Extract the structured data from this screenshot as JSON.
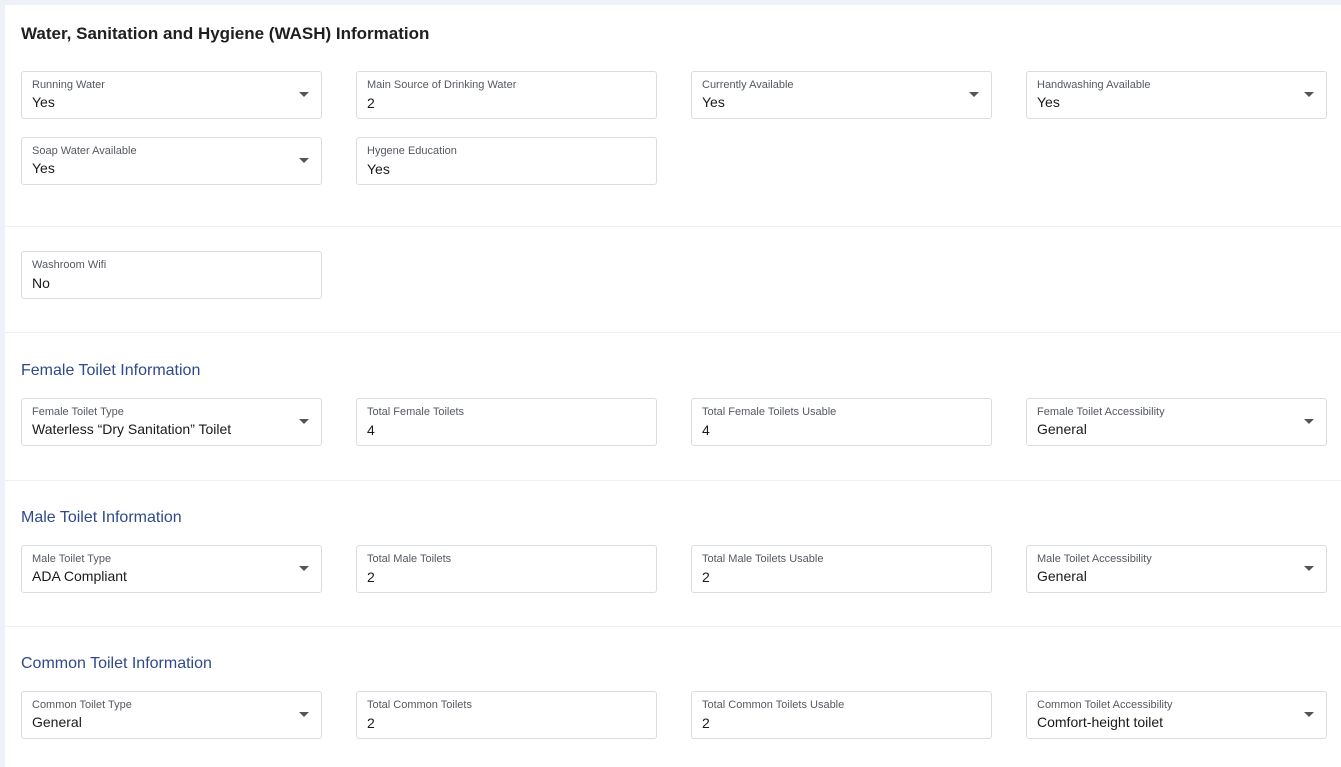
{
  "wash": {
    "title": "Water, Sanitation and Hygiene (WASH) Information",
    "running_water": {
      "label": "Running Water",
      "value": "Yes"
    },
    "main_source": {
      "label": "Main Source of Drinking Water",
      "value": "2"
    },
    "currently_available": {
      "label": "Currently Available",
      "value": "Yes"
    },
    "handwashing": {
      "label": "Handwashing Available",
      "value": "Yes"
    },
    "soap_water": {
      "label": "Soap Water Available",
      "value": "Yes"
    },
    "hygiene_education": {
      "label": "Hygene Education",
      "value": "Yes"
    },
    "washroom_wifi": {
      "label": "Washroom Wifi",
      "value": "No"
    }
  },
  "female": {
    "title": "Female Toilet Information",
    "type": {
      "label": "Female Toilet Type",
      "value": "Waterless “Dry Sanitation” Toilet"
    },
    "total": {
      "label": "Total Female Toilets",
      "value": "4"
    },
    "usable": {
      "label": "Total Female Toilets Usable",
      "value": "4"
    },
    "accessibility": {
      "label": "Female Toilet Accessibility",
      "value": "General"
    }
  },
  "male": {
    "title": "Male Toilet Information",
    "type": {
      "label": "Male Toilet Type",
      "value": "ADA Compliant"
    },
    "total": {
      "label": "Total Male Toilets",
      "value": "2"
    },
    "usable": {
      "label": "Total Male Toilets Usable",
      "value": "2"
    },
    "accessibility": {
      "label": "Male Toilet Accessibility",
      "value": "General"
    }
  },
  "common": {
    "title": "Common Toilet Information",
    "type": {
      "label": "Common Toilet Type",
      "value": "General"
    },
    "total": {
      "label": "Total Common Toilets",
      "value": "2"
    },
    "usable": {
      "label": "Total Common Toilets Usable",
      "value": "2"
    },
    "accessibility": {
      "label": "Common Toilet Accessibility",
      "value": "Comfort-height toilet"
    }
  }
}
